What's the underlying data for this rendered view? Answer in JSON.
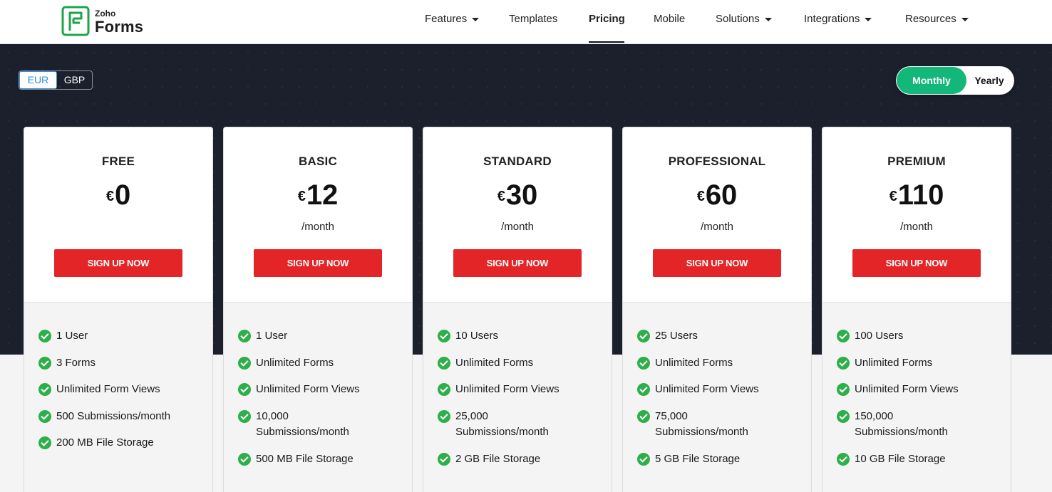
{
  "brand": {
    "zoho": "Zoho",
    "forms": "Forms",
    "accent": "#1fa34a"
  },
  "nav": [
    {
      "label": "Features",
      "dropdown": true
    },
    {
      "label": "Templates",
      "dropdown": false
    },
    {
      "label": "Pricing",
      "dropdown": false,
      "active": true
    },
    {
      "label": "Mobile",
      "dropdown": false
    },
    {
      "label": "Solutions",
      "dropdown": true
    },
    {
      "label": "Integrations",
      "dropdown": true
    },
    {
      "label": "Resources",
      "dropdown": true
    }
  ],
  "currency": {
    "options": [
      "EUR",
      "GBP"
    ],
    "selected": "EUR"
  },
  "billing": {
    "monthly": "Monthly",
    "yearly": "Yearly",
    "selected": "Monthly",
    "accent": "#13b77a"
  },
  "cta_color": "#e42528",
  "plans": [
    {
      "name": "FREE",
      "currency": "€",
      "price": "0",
      "period": "",
      "cta": "SIGN UP NOW",
      "features": [
        "1 User",
        "3 Forms",
        "Unlimited Form Views",
        "500 Submissions/month",
        "200 MB File Storage"
      ]
    },
    {
      "name": "BASIC",
      "currency": "€",
      "price": "12",
      "period": "/month",
      "cta": "SIGN UP NOW",
      "features": [
        "1 User",
        "Unlimited Forms",
        "Unlimited Form Views",
        "10,000 Submissions/month",
        "500 MB File Storage"
      ]
    },
    {
      "name": "STANDARD",
      "currency": "€",
      "price": "30",
      "period": "/month",
      "cta": "SIGN UP NOW",
      "features": [
        "10 Users",
        "Unlimited Forms",
        "Unlimited Form Views",
        "25,000 Submissions/month",
        "2 GB File Storage"
      ]
    },
    {
      "name": "PROFESSIONAL",
      "currency": "€",
      "price": "60",
      "period": "/month",
      "cta": "SIGN UP NOW",
      "features": [
        "25 Users",
        "Unlimited Forms",
        "Unlimited Form Views",
        "75,000 Submissions/month",
        "5 GB File Storage"
      ]
    },
    {
      "name": "PREMIUM",
      "currency": "€",
      "price": "110",
      "period": "/month",
      "cta": "SIGN UP NOW",
      "features": [
        "100 Users",
        "Unlimited Forms",
        "Unlimited Form Views",
        "150,000 Submissions/month",
        "10 GB File Storage"
      ]
    }
  ]
}
